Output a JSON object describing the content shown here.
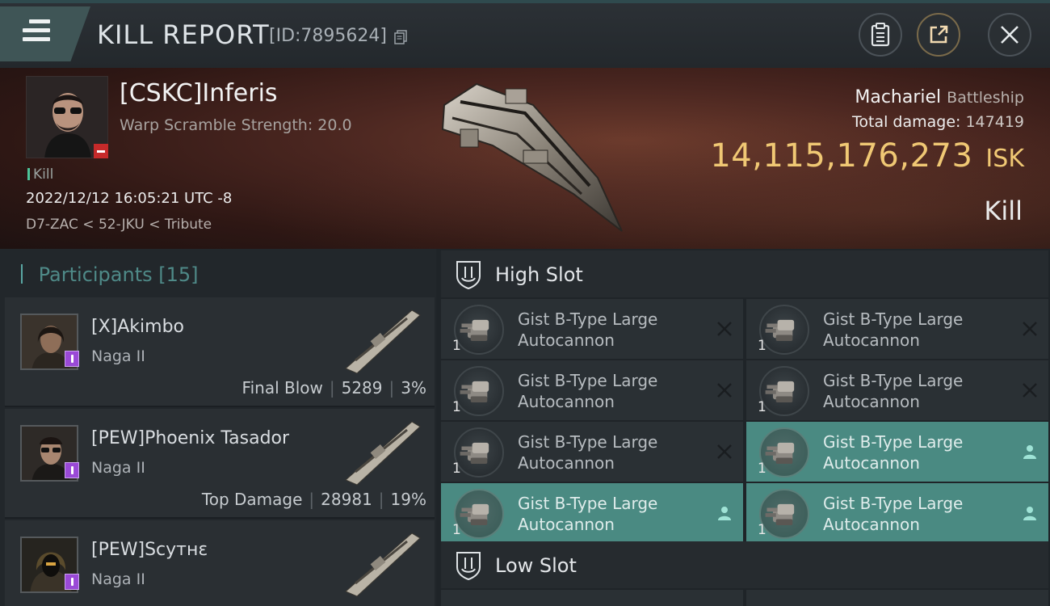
{
  "header": {
    "title": "KILL REPORT",
    "report_id": "[ID:7895624]"
  },
  "victim": {
    "name": "[CSKC]Inferis",
    "scramble": "Warp Scramble Strength: 20.0",
    "kill_tag": "Kill",
    "timestamp": "2022/12/12 16:05:21 UTC -8",
    "location": "D7-ZAC < 52-JKU < Tribute",
    "ship_name": "Machariel",
    "ship_class": "Battleship",
    "total_damage_label": "Total damage:",
    "total_damage": "147419",
    "isk_value": "14,115,176,273",
    "isk_unit": "ISK",
    "outcome": "Kill"
  },
  "participants": {
    "title": "Participants",
    "count": "[15]",
    "items": [
      {
        "name": "[X]Akimbo",
        "ship": "Naga II",
        "role": "Final Blow",
        "damage": "5289",
        "percent": "3%"
      },
      {
        "name": "[PEW]Phoenix Tasador",
        "ship": "Naga II",
        "role": "Top Damage",
        "damage": "28981",
        "percent": "19%"
      },
      {
        "name": "[PEW]Scyтнɛ",
        "ship": "Naga II",
        "role": "",
        "damage": "",
        "percent": ""
      }
    ]
  },
  "slots": {
    "high_title": "High Slot",
    "low_title": "Low Slot",
    "high_modules": [
      {
        "line1": "Gist B-Type Large",
        "line2": "Autocannon",
        "qty": "1",
        "status": "destroyed"
      },
      {
        "line1": "Gist B-Type Large",
        "line2": "Autocannon",
        "qty": "1",
        "status": "destroyed"
      },
      {
        "line1": "Gist B-Type Large",
        "line2": "Autocannon",
        "qty": "1",
        "status": "destroyed"
      },
      {
        "line1": "Gist B-Type Large",
        "line2": "Autocannon",
        "qty": "1",
        "status": "destroyed"
      },
      {
        "line1": "Gist B-Type Large",
        "line2": "Autocannon",
        "qty": "1",
        "status": "destroyed"
      },
      {
        "line1": "Gist B-Type Large",
        "line2": "Autocannon",
        "qty": "1",
        "status": "dropped"
      },
      {
        "line1": "Gist B-Type Large",
        "line2": "Autocannon",
        "qty": "1",
        "status": "dropped"
      },
      {
        "line1": "Gist B-Type Large",
        "line2": "Autocannon",
        "qty": "1",
        "status": "dropped"
      }
    ]
  },
  "colors": {
    "accent_teal": "#4a8a82",
    "isk_gold": "#f0c874",
    "minus_red": "#c62a2a",
    "tag_purple": "#9a49d6"
  }
}
